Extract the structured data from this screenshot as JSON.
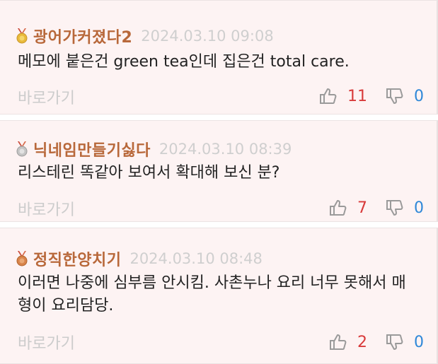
{
  "comments": [
    {
      "medal": "gold",
      "nickname": "광어가커졌다2",
      "date": "2024.03.10 09:08",
      "text": "메모에 붙은건 green tea인데 집은건 total care.",
      "goto_label": "바로가기",
      "upvotes": "11",
      "downvotes": "0"
    },
    {
      "medal": "silver",
      "nickname": "닉네임만들기싫다",
      "date": "2024.03.10 08:39",
      "text": "리스테린 똑같아 보여서 확대해 보신 분?",
      "goto_label": "바로가기",
      "upvotes": "7",
      "downvotes": "0"
    },
    {
      "medal": "bronze",
      "nickname": "정직한양치기",
      "date": "2024.03.10 08:48",
      "text": "이러면 나중에 심부름 안시킴. 사촌누나 요리 너무 못해서 매형이 요리담당.",
      "goto_label": "바로가기",
      "upvotes": "2",
      "downvotes": "0"
    }
  ],
  "colors": {
    "background": "#fdf3f3",
    "nickname": "#b8683a",
    "upvote": "#d83a3a",
    "downvote": "#2f88d8",
    "muted": "#cccccc"
  },
  "icons": {
    "medal": "medal-icon",
    "upvote": "thumbs-up-icon",
    "downvote": "thumbs-down-icon"
  }
}
